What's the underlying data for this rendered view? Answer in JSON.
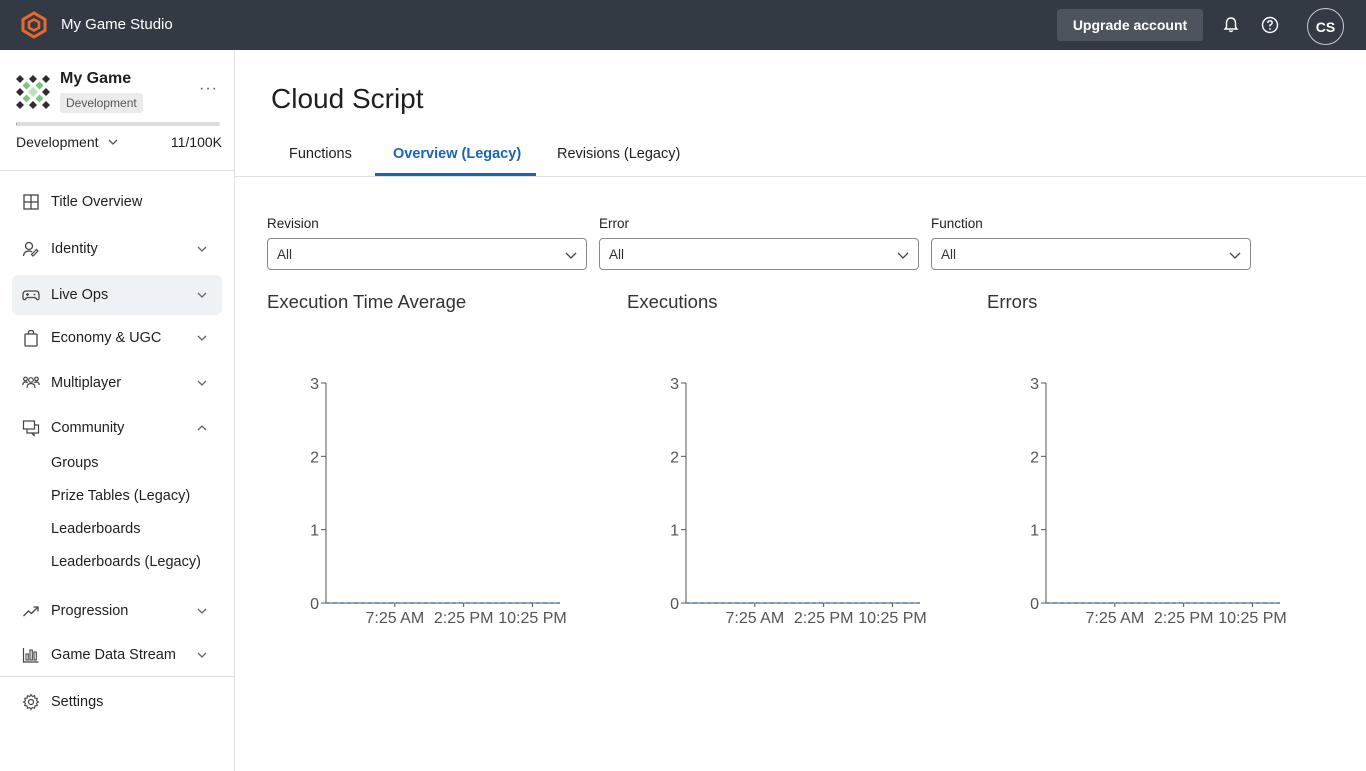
{
  "topbar": {
    "studio_name": "My Game Studio",
    "upgrade_label": "Upgrade account",
    "avatar_initials": "CS",
    "bg_color": "#333a44",
    "logo_color": "#e8692f"
  },
  "sidebar": {
    "game_name": "My Game",
    "environment_badge": "Development",
    "environment_select": "Development",
    "usage_count": "11/100K",
    "usage_fraction": 0.00011,
    "items": [
      {
        "label": "Title Overview",
        "icon": "grid-icon",
        "chevron": "none"
      },
      {
        "label": "Identity",
        "icon": "identity-icon",
        "chevron": "down"
      },
      {
        "label": "Live Ops",
        "icon": "gamepad-icon",
        "chevron": "down",
        "active": true
      },
      {
        "label": "Economy & UGC",
        "icon": "bag-icon",
        "chevron": "down"
      },
      {
        "label": "Multiplayer",
        "icon": "people-icon",
        "chevron": "down"
      },
      {
        "label": "Community",
        "icon": "chat-icon",
        "chevron": "up"
      },
      {
        "label": "Progression",
        "icon": "trend-icon",
        "chevron": "down"
      },
      {
        "label": "Game Data Stream",
        "icon": "bar-chart-icon",
        "chevron": "down"
      }
    ],
    "community_subitems": [
      "Groups",
      "Prize Tables (Legacy)",
      "Leaderboards",
      "Leaderboards (Legacy)"
    ],
    "settings_label": "Settings"
  },
  "main": {
    "page_title": "Cloud Script",
    "tabs": [
      {
        "label": "Functions",
        "active": false
      },
      {
        "label": "Overview (Legacy)",
        "active": true
      },
      {
        "label": "Revisions (Legacy)",
        "active": false
      }
    ],
    "filters": [
      {
        "label": "Revision",
        "value": "All"
      },
      {
        "label": "Error",
        "value": "All"
      },
      {
        "label": "Function",
        "value": "All"
      }
    ],
    "accent_color": "#1b63b6"
  },
  "chart_data": [
    {
      "type": "line",
      "title": "Execution Time Average",
      "x_tick_labels": [
        "7:25 AM",
        "2:25 PM",
        "10:25 PM"
      ],
      "y_ticks": [
        0,
        1,
        2,
        3
      ],
      "ylim": [
        0,
        3
      ],
      "series": [
        {
          "values": [
            0,
            0,
            0,
            0
          ]
        }
      ],
      "grid": false
    },
    {
      "type": "line",
      "title": "Executions",
      "x_tick_labels": [
        "7:25 AM",
        "2:25 PM",
        "10:25 PM"
      ],
      "y_ticks": [
        0,
        1,
        2,
        3
      ],
      "ylim": [
        0,
        3
      ],
      "series": [
        {
          "values": [
            0,
            0,
            0,
            0
          ]
        }
      ],
      "grid": false
    },
    {
      "type": "line",
      "title": "Errors",
      "x_tick_labels": [
        "7:25 AM",
        "2:25 PM",
        "10:25 PM"
      ],
      "y_ticks": [
        0,
        1,
        2,
        3
      ],
      "ylim": [
        0,
        3
      ],
      "series": [
        {
          "values": [
            0,
            0,
            0,
            0
          ]
        }
      ],
      "grid": false
    }
  ]
}
